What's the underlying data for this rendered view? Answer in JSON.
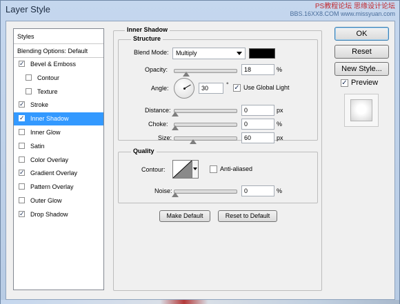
{
  "window": {
    "title": "Layer Style",
    "watermark_line1": "PS教程论坛  思缘设计论坛",
    "watermark_line2": "BBS.16XX8.COM  www.missyuan.com"
  },
  "styles_list": {
    "header": "Styles",
    "blending": "Blending Options: Default",
    "items": [
      {
        "label": "Bevel & Emboss",
        "checked": true
      },
      {
        "label": "Contour",
        "checked": false
      },
      {
        "label": "Texture",
        "checked": false
      },
      {
        "label": "Stroke",
        "checked": true
      },
      {
        "label": "Inner Shadow",
        "checked": true,
        "selected": true
      },
      {
        "label": "Inner Glow",
        "checked": false
      },
      {
        "label": "Satin",
        "checked": false
      },
      {
        "label": "Color Overlay",
        "checked": false
      },
      {
        "label": "Gradient Overlay",
        "checked": true
      },
      {
        "label": "Pattern Overlay",
        "checked": false
      },
      {
        "label": "Outer Glow",
        "checked": false
      },
      {
        "label": "Drop Shadow",
        "checked": true
      }
    ]
  },
  "inner_shadow": {
    "title": "Inner Shadow",
    "structure_title": "Structure",
    "blend_mode_label": "Blend Mode:",
    "blend_mode_value": "Multiply",
    "blend_color": "#000000",
    "opacity_label": "Opacity:",
    "opacity_value": "18",
    "opacity_unit": "%",
    "opacity_level": 0.18,
    "angle_label": "Angle:",
    "angle_value": "30",
    "angle_unit": "°",
    "use_global_light_label": "Use Global Light",
    "use_global_light": true,
    "distance_label": "Distance:",
    "distance_value": "0",
    "distance_unit": "px",
    "choke_label": "Choke:",
    "choke_value": "0",
    "choke_unit": "%",
    "size_label": "Size:",
    "size_value": "60",
    "size_unit": "px",
    "quality_title": "Quality",
    "contour_label": "Contour:",
    "anti_aliased_label": "Anti-aliased",
    "anti_aliased": false,
    "noise_label": "Noise:",
    "noise_value": "0",
    "noise_unit": "%",
    "make_default_label": "Make Default",
    "reset_default_label": "Reset to Default"
  },
  "buttons": {
    "ok": "OK",
    "reset": "Reset",
    "new_style": "New Style...",
    "preview_label": "Preview",
    "preview_checked": true
  }
}
